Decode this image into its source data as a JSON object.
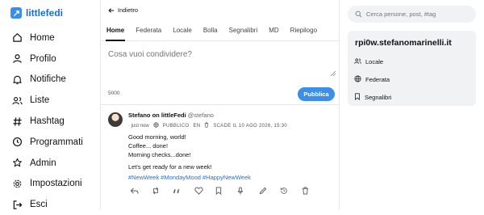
{
  "brand": {
    "name": "littlefedi"
  },
  "sidebar": {
    "items": [
      {
        "label": "Home",
        "icon": "home-icon"
      },
      {
        "label": "Profilo",
        "icon": "user-icon"
      },
      {
        "label": "Notifiche",
        "icon": "bell-icon"
      },
      {
        "label": "Liste",
        "icon": "users-icon"
      },
      {
        "label": "Hashtag",
        "icon": "hash-icon"
      },
      {
        "label": "Programmati",
        "icon": "clock-icon"
      },
      {
        "label": "Admin",
        "icon": "star-icon"
      },
      {
        "label": "Impostazioni",
        "icon": "gear-icon"
      },
      {
        "label": "Esci",
        "icon": "logout-icon"
      }
    ]
  },
  "main": {
    "back_label": "Indietro",
    "tabs": [
      "Home",
      "Federata",
      "Locale",
      "Bolla",
      "Segnalibri",
      "MD",
      "Riepilogo"
    ],
    "active_tab": "Home",
    "compose": {
      "placeholder": "Cosa vuoi condividere?",
      "char_count": "5000",
      "publish_label": "Pubblica"
    }
  },
  "post": {
    "author": "Stefano on littleFedi",
    "handle": "@stefano",
    "time": "· just now",
    "visibility": "PUBBLICO",
    "language": "EN",
    "expiry": "SCADE IL 10 AGO 2026, 15:30",
    "lines": [
      "Good morning, world!",
      "Coffee... done!",
      "Morning checks...done!",
      "",
      "Let's get ready for a new week!"
    ],
    "hashtags": "#NewWeek #MondayMood #HappyNewWeek"
  },
  "right": {
    "search_placeholder": "Cerca persone, post, #tag",
    "instance": "rpi0w.stefanomarinelli.it",
    "links": [
      {
        "label": "Locale",
        "icon": "users-icon"
      },
      {
        "label": "Federata",
        "icon": "globe-icon"
      },
      {
        "label": "Segnalibri",
        "icon": "bookmark-icon"
      }
    ]
  },
  "colors": {
    "accent": "#3b8fe8",
    "hashtag": "#2b6fd1",
    "panel": "#f1f2f4",
    "border": "#e8e8e8"
  }
}
